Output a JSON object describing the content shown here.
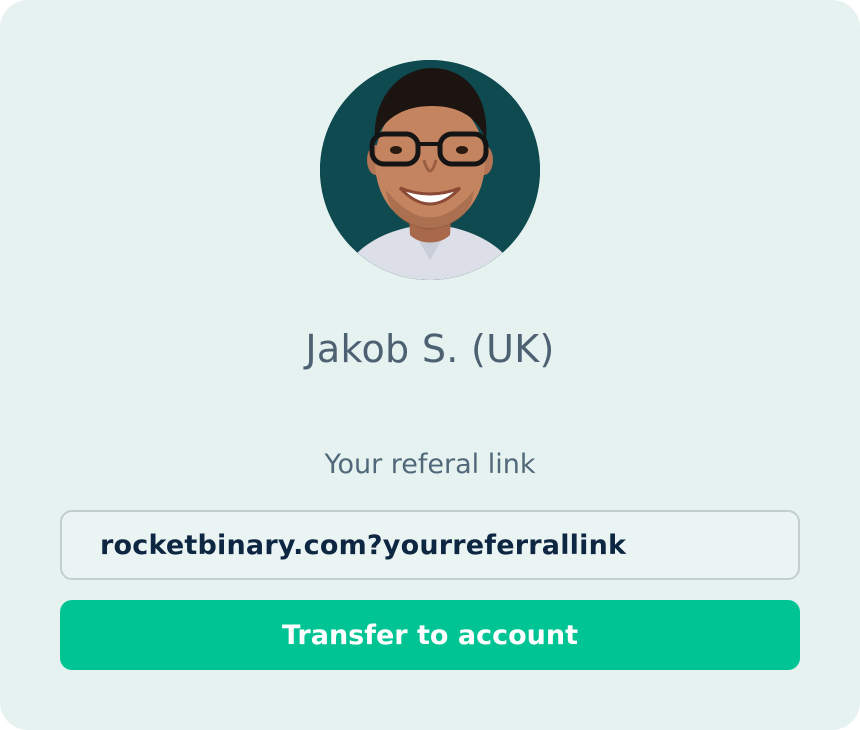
{
  "profile": {
    "name": "Jakob S. (UK)",
    "avatar_icon": "user-photo"
  },
  "referral": {
    "label": "Your referal link",
    "link_value": "rocketbinary.com?yourreferrallink"
  },
  "actions": {
    "transfer_label": "Transfer to account"
  },
  "colors": {
    "card_background": "#e5f2f0",
    "avatar_background": "#0e4a4f",
    "name_text": "#4d6173",
    "link_text": "#0d2642",
    "button_background": "#00c493",
    "button_text": "#ffffff"
  }
}
